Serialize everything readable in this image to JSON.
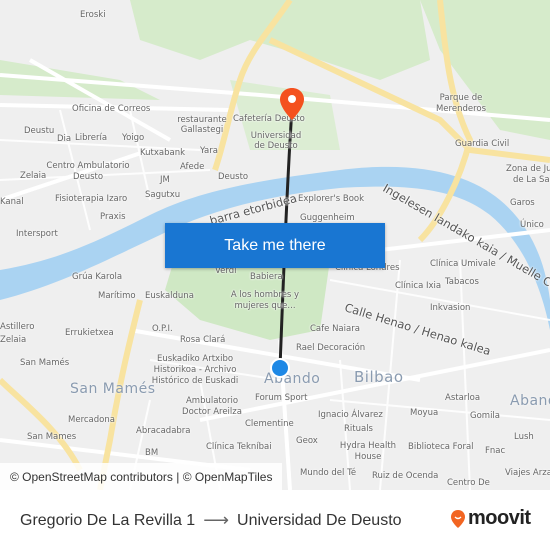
{
  "map": {
    "labels": [
      "Eroski",
      "Oficina de Correos",
      "restaurante",
      "Gallastegi",
      "Cafetería Deusto",
      "Universidad",
      "de Deusto",
      "Parque de",
      "Merenderos",
      "Guardia Civil",
      "Deustu",
      "Dia",
      "Librería",
      "Yoigo",
      "Kutxabank",
      "Yara",
      "Afede",
      "Centro Ambulatorio",
      "Deusto",
      "Zelaia",
      "JM",
      "Deusto",
      "Fisioterapia Izaro",
      "Sagutxu",
      "Praxis",
      "Intersport",
      "Explorer's Book",
      "Guggenheim",
      "Zona de Ju",
      "de La Sa",
      "Garos",
      "Único",
      "Grúa Karola",
      "Marítimo",
      "Euskalduna",
      "Verdi",
      "Babiera",
      "Clínica Londres",
      "Clínica Umivale",
      "Clínica Ixia",
      "Tabacos",
      "A los hombres y",
      "mujeres que...",
      "Inkvasion",
      "Cafe Naiara",
      "Astillero",
      "Errukietxea",
      "O.P.I.",
      "Rosa Clará",
      "Rael Decoración",
      "San Mamés",
      "Euskadiko Artxibo",
      "Historikoa - Archivo",
      "Histórico de Euskadi",
      "Forum Sport",
      "Ambulatorio",
      "Doctor Areilza",
      "Astarloa",
      "Moyua",
      "Gomila",
      "Ignacio Álvarez",
      "Mercadona",
      "Abracadabra",
      "Clementine",
      "Lush",
      "San Mames",
      "Clínica Tekníbai",
      "Geox",
      "Rituals",
      "Hydra Health",
      "House",
      "Biblioteca Foral",
      "Fnac",
      "BM",
      "Mundo del Té",
      "Ruiz de Ocenda",
      "Viajes Arza",
      "Centro De",
      "Kanal",
      "Zelaia"
    ],
    "big_labels": [
      "San Mamés",
      "Abando",
      "Bilbao",
      "Abando"
    ],
    "streets": [
      "Calle Henao / Henao kalea",
      "Ingelesen landako kaia / Muelle Campo",
      "barra etorbidea"
    ],
    "colors": {
      "water": "#aad3f2",
      "park": "#cfe8c4",
      "major_road": "#fbe6a2",
      "route": "#222222",
      "destination_pin": "#f4511e",
      "origin_dot": "#1e88e5"
    }
  },
  "cta": {
    "label": "Take me there",
    "color": "#1976d2"
  },
  "attribution": "© OpenStreetMap contributors | © OpenMapTiles",
  "footer": {
    "origin": "Gregorio De La Revilla 1",
    "arrow_icon": "arrow-right-icon",
    "destination": "Universidad De Deusto",
    "logo": "moovit",
    "logo_color": "#f26522"
  }
}
